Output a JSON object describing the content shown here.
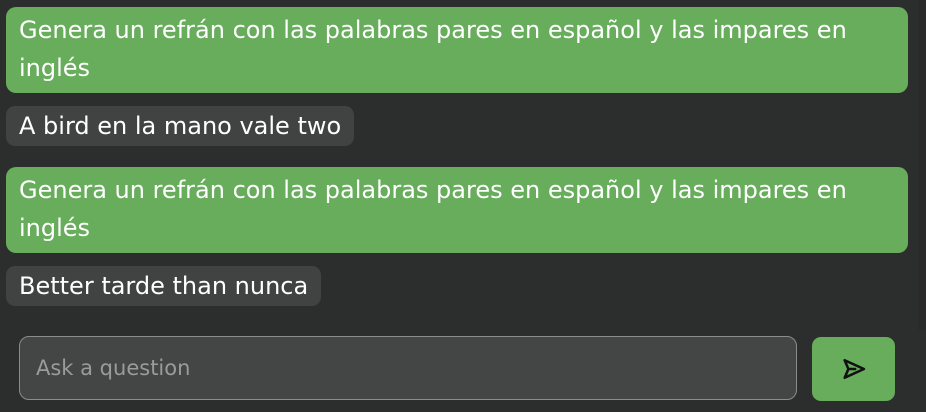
{
  "theme": {
    "accent": "#67ad5b",
    "background": "#2c2d2d",
    "bot_bubble": "#414242"
  },
  "conversation": {
    "messages": [
      {
        "role": "user",
        "text": "Genera un refrán con las palabras pares en español y las impares en inglés"
      },
      {
        "role": "assistant",
        "text": "A bird en la mano vale two"
      },
      {
        "role": "user",
        "text": "Genera un refrán con las palabras pares en español y las impares en inglés"
      },
      {
        "role": "assistant",
        "text": "Better tarde than nunca"
      }
    ]
  },
  "composer": {
    "placeholder": "Ask a question",
    "value": "",
    "send_icon": "send-arrow-icon"
  }
}
